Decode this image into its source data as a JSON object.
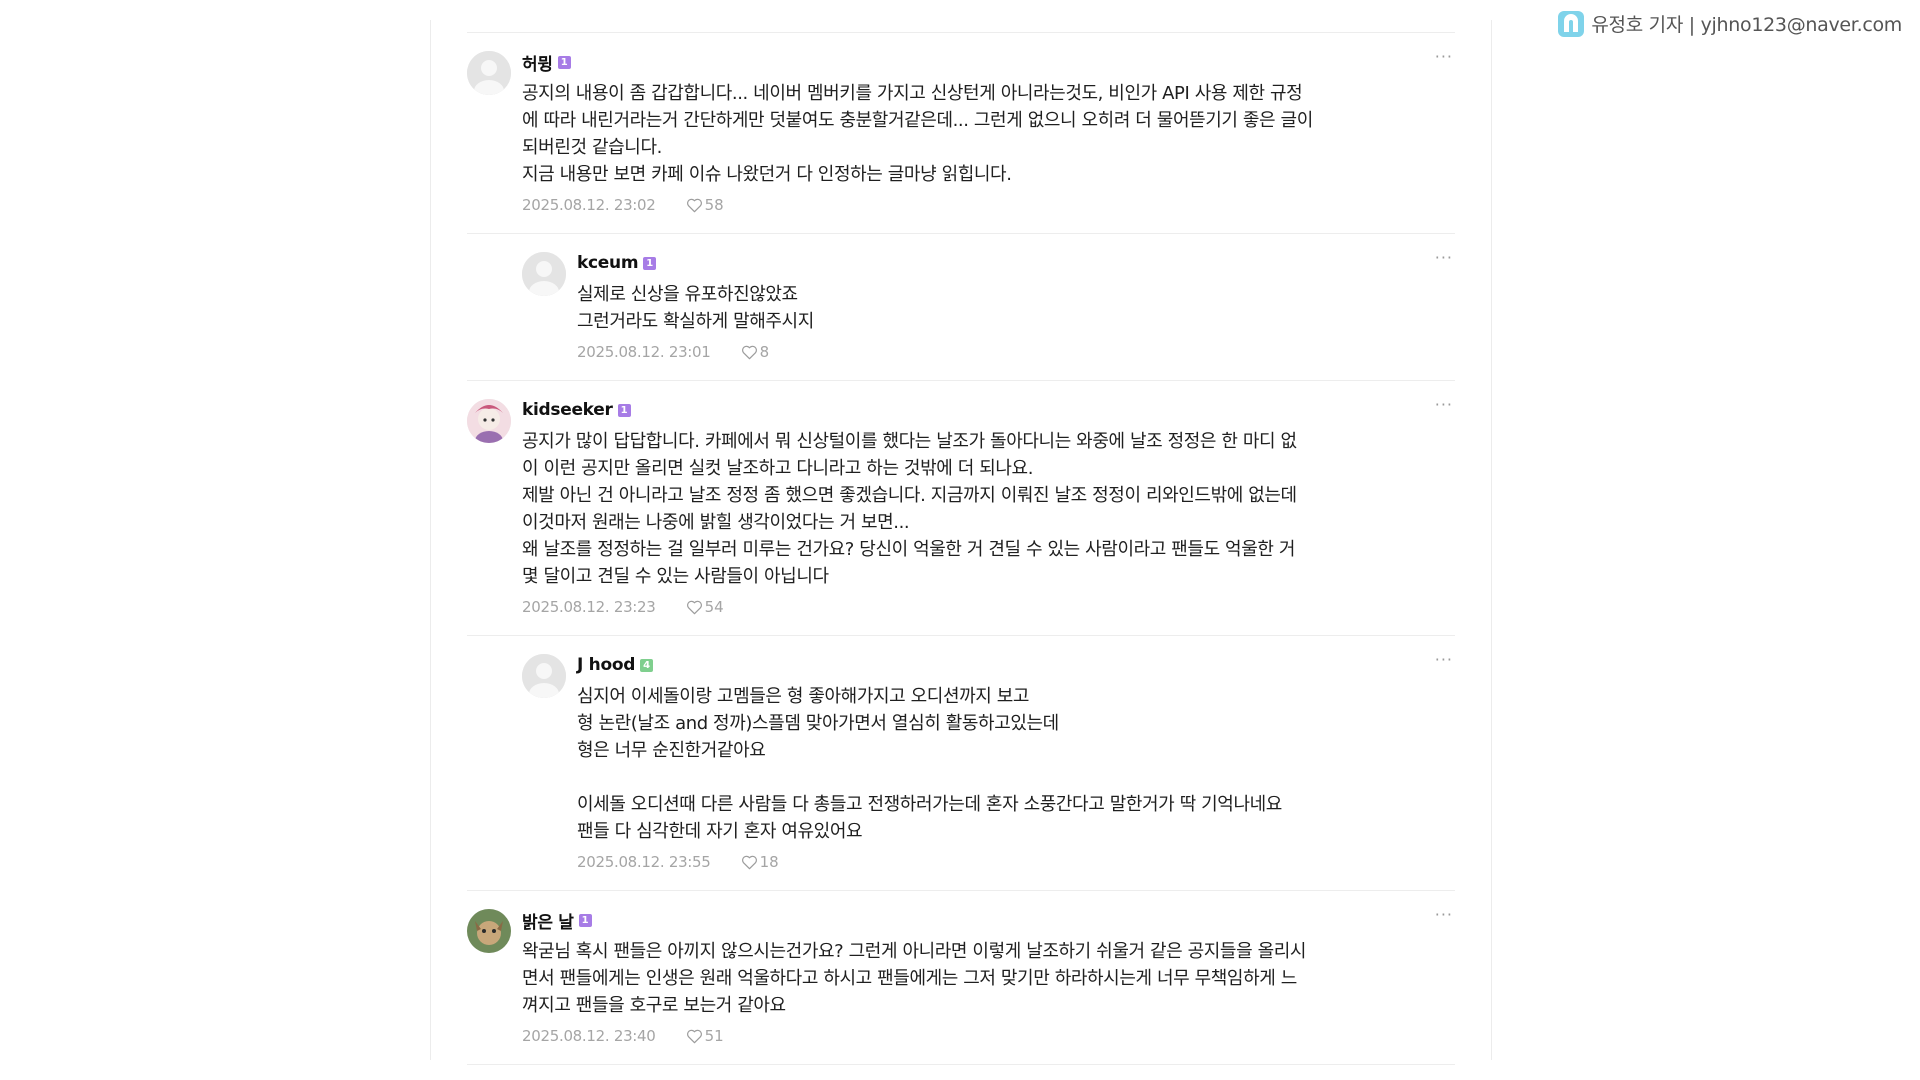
{
  "watermark": {
    "text": "유정호 기자 | yjhno123@naver.com",
    "logo_icon": "news-logo-icon"
  },
  "more_label": "···",
  "comments": [
    {
      "nick": "허뮝",
      "level": "1",
      "text": "공지의 내용이 좀 갑갑합니다... 네이버 멤버키를 가지고 신상턴게 아니라는것도, 비인가 API 사용 제한 규정\n에 따라 내린거라는거 간단하게만 덧붙여도 충분할거같은데... 그런게 없으니 오히려 더 물어뜯기기 좋은 글이\n되버린것 같습니다.\n지금 내용만 보면 카페 이슈 나왔던거 다 인정하는 글마냥 읽힙니다.",
      "date": "2025.08.12. 23:02",
      "likes": "58"
    },
    {
      "nick": "kceum",
      "level": "1",
      "text": "실제로 신상을 유포하진않았죠\n그런거라도 확실하게 말해주시지",
      "date": "2025.08.12. 23:01",
      "likes": "8"
    },
    {
      "nick": "kidseeker",
      "level": "1",
      "text": "공지가 많이 답답합니다. 카페에서 뭐 신상털이를 했다는 날조가 돌아다니는 와중에 날조 정정은 한 마디 없\n이 이런 공지만 올리면 실컷 날조하고 다니라고 하는 것밖에 더 되나요.\n제발 아닌 건 아니라고 날조 정정 좀 했으면 좋겠습니다. 지금까지 이뤄진 날조 정정이 리와인드밖에 없는데\n이것마저 원래는 나중에 밝힐 생각이었다는 거 보면...\n왜 날조를 정정하는 걸 일부러 미루는 건가요? 당신이 억울한 거 견딜 수 있는 사람이라고 팬들도 억울한 거\n몇 달이고 견딜 수 있는 사람들이 아닙니다",
      "date": "2025.08.12. 23:23",
      "likes": "54"
    },
    {
      "nick": "J hood",
      "level": "4",
      "text": "심지어 이세돌이랑 고멤들은 형 좋아해가지고 오디션까지 보고\n형 논란(날조 and 정까)스플뎀 맞아가면서 열심히 활동하고있는데\n형은 너무 순진한거같아요\n\n이세돌 오디션때 다른 사람들 다 총들고 전쟁하러가는데 혼자 소풍간다고 말한거가 딱 기억나네요\n팬들 다 심각한데 자기 혼자 여유있어요",
      "date": "2025.08.12. 23:55",
      "likes": "18"
    },
    {
      "nick": "밝은 날",
      "level": "1",
      "text": "왁굳님 혹시 팬들은 아끼지 않으시는건가요? 그런게 아니라면 이렇게 날조하기 쉬울거 같은 공지들을 올리시\n면서 팬들에게는 인생은 원래 억울하다고 하시고 팬들에게는 그저 맞기만 하라하시는게 너무 무책임하게 느\n껴지고 팬들을 호구로 보는거 같아요",
      "date": "2025.08.12. 23:40",
      "likes": "51"
    }
  ]
}
